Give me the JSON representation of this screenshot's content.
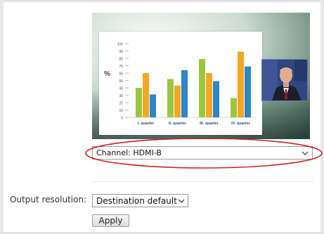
{
  "preview": {
    "slide_chart": {
      "ylabel": "%",
      "categories": [
        "I. quarter",
        "II. quarter",
        "III. quarter",
        "IV. quarter"
      ],
      "y_ticks": [
        "0",
        "10",
        "20",
        "30",
        "40",
        "50",
        "60",
        "70",
        "80",
        "90",
        "100"
      ],
      "ylim": [
        0,
        100
      ],
      "series": [
        {
          "values": [
            40,
            52,
            79,
            26
          ],
          "color": "#9cc63f"
        },
        {
          "values": [
            60,
            43,
            60,
            89
          ],
          "color": "#f5a623"
        },
        {
          "values": [
            31,
            64,
            49,
            69
          ],
          "color": "#2c86c8"
        }
      ]
    }
  },
  "channel_select": {
    "value": "Channel: HDMI-B"
  },
  "output_resolution": {
    "label": "Output resolution:",
    "value": "Destination default"
  },
  "apply_button": {
    "label": "Apply"
  },
  "colors": {
    "highlight": "#d21f1f"
  }
}
